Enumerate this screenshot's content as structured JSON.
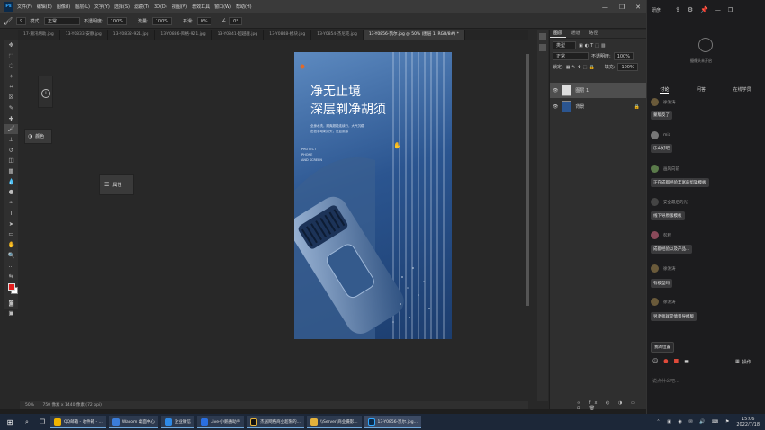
{
  "ps": {
    "logo": "Ps",
    "menu": [
      "文件(F)",
      "编辑(E)",
      "图像(I)",
      "图层(L)",
      "文字(Y)",
      "选择(S)",
      "滤镜(T)",
      "3D(D)",
      "视图(V)",
      "增效工具",
      "窗口(W)",
      "帮助(H)"
    ],
    "window_controls": [
      "—",
      "❐",
      "✕"
    ],
    "options": {
      "mode_label": "模式:",
      "mode_value": "正常",
      "opacity_label": "不透明度:",
      "opacity_value": "100%",
      "flow_label": "流量:",
      "flow_value": "100%",
      "smooth_label": "平滑:",
      "smooth_value": "0%",
      "angle_value": "0°"
    },
    "tabs": [
      "17-潮汛胡助.jpg",
      "13-Y0833-安静.jpg",
      "13-Y0832-921.jpg",
      "13-Y0836-网格-921.jpg",
      "13-Y0841-超越趣.jpg",
      "13-Y0848-模块.jpg",
      "13-Y0854-杰尼克.jpg",
      "13-Y0856-凯尔.jpg @ 50% (图层 1, RGB/8#) *"
    ],
    "active_tab": 7,
    "float_panels": {
      "color": "颜色",
      "properties": "属性"
    },
    "status": {
      "zoom": "50%",
      "size": "750 像素 x 1440 像素 (72 ppi)"
    },
    "poster": {
      "title1": "净无止境",
      "title2": "深层剃净胡须",
      "body1": "全身水洗，顺爽超能连续行，大气沉稳",
      "body2": "出色手动剃刀头，更显质感",
      "en1": "PROTECT",
      "en2": "PHONE",
      "en3": "AND SCREEN"
    },
    "layers": {
      "tabs": [
        "图层",
        "通道",
        "路径"
      ],
      "kind": "类型",
      "blend": "正常",
      "opacity_label": "不透明度:",
      "opacity": "100%",
      "lock_label": "锁定:",
      "fill_label": "填充:",
      "fill": "100%",
      "items": [
        {
          "name": "图层 1"
        },
        {
          "name": "背景"
        }
      ]
    }
  },
  "chat": {
    "user": "研彦",
    "cam": "摄像头未开启",
    "tabs": [
      "讨论",
      "问答",
      "在线学员"
    ],
    "messages": [
      {
        "name": "徐洪涛",
        "text": "蒙版反了"
      },
      {
        "name": "mia",
        "text": "乐山好吧"
      },
      {
        "name": "画风向前",
        "text": "正在成都经验丰富的剪辑模板"
      },
      {
        "name": "安全最后的光",
        "text": "线下导原版模板"
      },
      {
        "name": "彭程",
        "text": "成都经验以及产品..."
      },
      {
        "name": "徐洪涛",
        "text": "有模型吗"
      },
      {
        "name": "徐洪涛",
        "text": "另老师就是情景导模版"
      }
    ],
    "position_btn": "我的位置",
    "ops": "操作",
    "input_placeholder": "说点什么吧..."
  },
  "taskbar": {
    "apps": [
      {
        "label": "QQ邮箱 - 收件箱 - ...",
        "color": "#f0b400"
      },
      {
        "label": "Wacom 桌面中心",
        "color": "#3b7dd8"
      },
      {
        "label": "企业微信",
        "color": "#2e8ae6"
      },
      {
        "label": "Live-小鹅通助手",
        "color": "#2a6fe0"
      },
      {
        "label": "杰居网络商业超限的...",
        "color": "#111111"
      },
      {
        "label": "\\\\Server\\商业摄影...",
        "color": "#e3b23c"
      },
      {
        "label": "13-Y0856-凯尔.jpg...",
        "color": "#0b2a4a"
      }
    ],
    "time": "15:06",
    "date": "2022/7/18"
  }
}
